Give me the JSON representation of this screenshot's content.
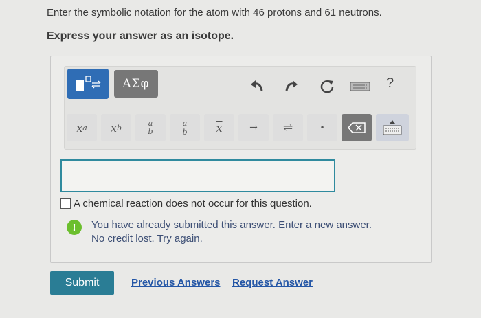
{
  "question": "Enter the symbolic notation for the atom with 46 protons and 61 neutrons.",
  "instruction": "Express your answer as an isotope.",
  "toolbar": {
    "greek_label": "ΑΣφ",
    "help_label": "?",
    "icons": [
      "templates-icon",
      "greek-letters-icon",
      "undo-icon",
      "redo-icon",
      "reset-icon",
      "keyboard-icon",
      "help-icon"
    ],
    "symbols": {
      "superscript": {
        "base": "x",
        "exp": "a"
      },
      "subscript": {
        "base": "x",
        "sub": "b"
      },
      "fraction_num": "a",
      "fraction_den": "b",
      "small_fraction_num": "a",
      "small_fraction_den": "b",
      "vector": "x",
      "arrow": "→",
      "equilibrium": "⇌",
      "dot": "•"
    }
  },
  "answer": {
    "value": ""
  },
  "no_reaction_label": "A chemical reaction does not occur for this question.",
  "feedback": {
    "icon": "!",
    "line1": "You have already submitted this answer. Enter a new answer.",
    "line2": "No credit lost. Try again."
  },
  "actions": {
    "submit": "Submit",
    "previous": "Previous Answers",
    "request": "Request Answer"
  },
  "colors": {
    "primary": "#2f6db5",
    "submit": "#2a7d95",
    "link": "#2456a6",
    "feedback_icon": "#6cbf2e",
    "feedback_text": "#3d4f75",
    "input_border": "#2f8a9e"
  }
}
